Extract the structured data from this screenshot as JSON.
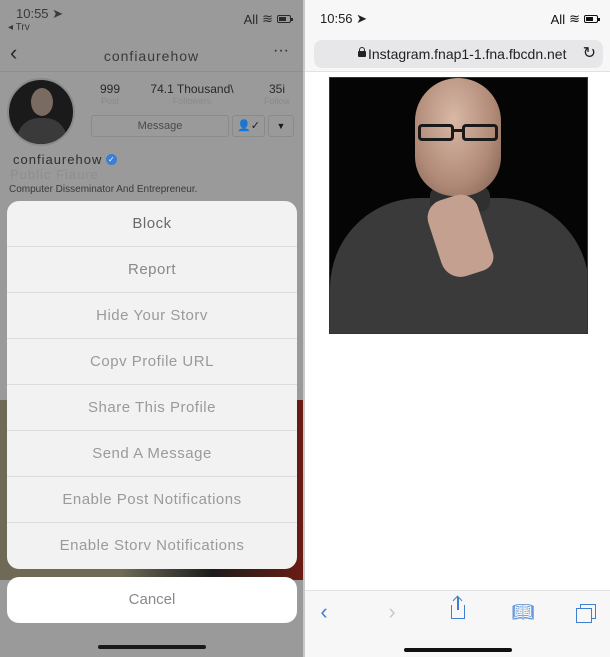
{
  "left_screen": {
    "status_bar": {
      "time": "10:55",
      "back_app": "Trv",
      "carrier": "All"
    },
    "nav": {
      "title": "confiaurehow",
      "back_icon": "chevron-left",
      "more_icon": "ellipsis"
    },
    "profile": {
      "stats": [
        {
          "value": "999",
          "label": "Post"
        },
        {
          "value": "74.1 Thousand\\",
          "label": "Followers"
        },
        {
          "value": "35i",
          "label": "Follow"
        }
      ],
      "message_button": "Message",
      "follow_icon": "person-check",
      "dropdown_icon": "caret-down",
      "username": "confiaurehow",
      "verified": "✓",
      "category": "Public Fiaure",
      "bio": "Computer Disseminator And Entrepreneur."
    },
    "action_sheet": {
      "items": [
        "Block",
        "Report",
        "Hide Your Storv",
        "Copv Profile URL",
        "Share This Profile",
        "Send A Message",
        "Enable Post Notifications",
        "Enable Storv Notifications"
      ],
      "cancel": "Cancel"
    }
  },
  "right_screen": {
    "status_bar": {
      "time": "10:56",
      "carrier": "All"
    },
    "url_bar": {
      "url": "Instagram.fnap1-1.fna.fbcdn.net"
    },
    "toolbar": {
      "back": "‹",
      "forward": "›",
      "bookmarks": "📖"
    }
  },
  "colors": {
    "accent": "#3f7fd1",
    "verified": "#3a7ed6",
    "dim_overlay": "#9a9a9a"
  }
}
